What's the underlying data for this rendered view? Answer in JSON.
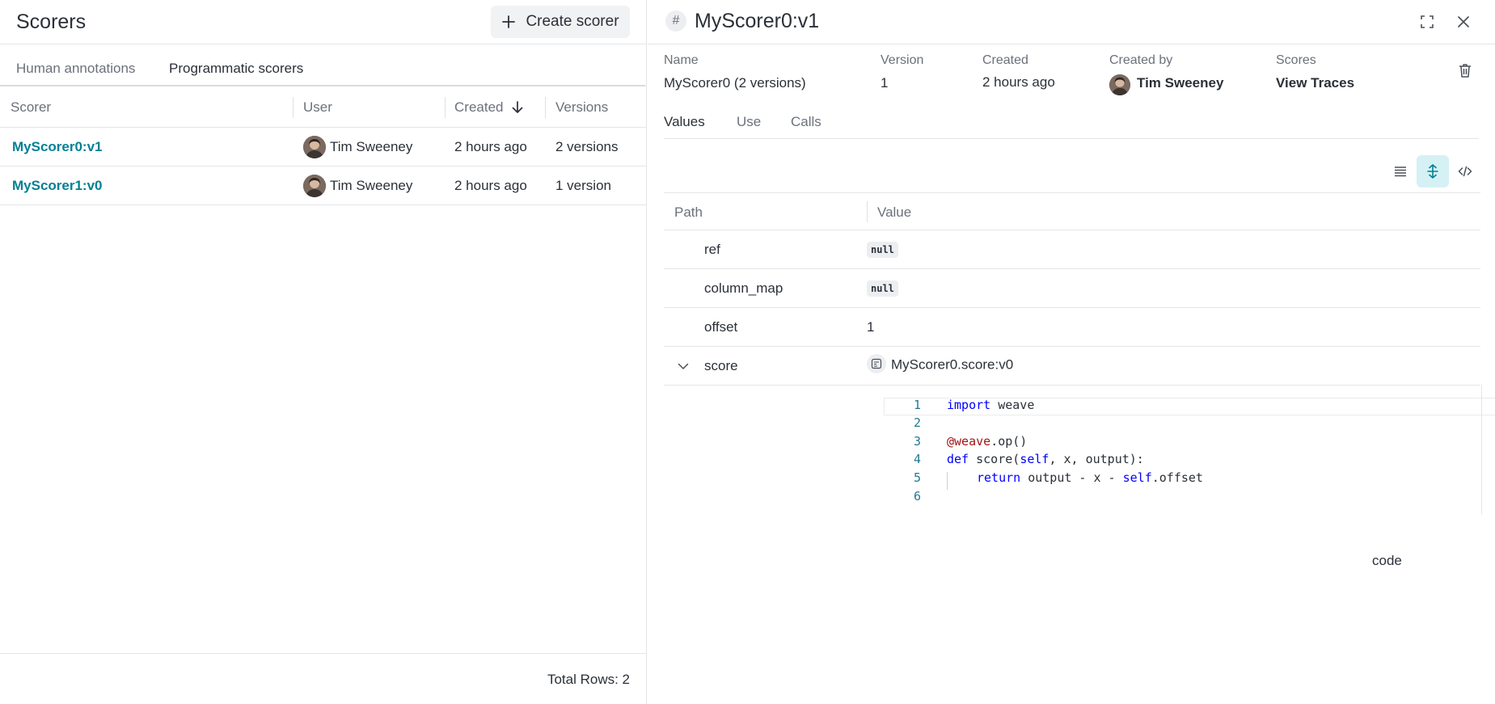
{
  "left": {
    "title": "Scorers",
    "create_button": "Create scorer",
    "tabs": [
      "Human annotations",
      "Programmatic scorers"
    ],
    "active_tab": "Programmatic scorers",
    "columns": [
      "Scorer",
      "User",
      "Created",
      "Versions"
    ],
    "rows": [
      {
        "scorer": "MyScorer0:v1",
        "user": "Tim Sweeney",
        "created": "2 hours ago",
        "versions": "2 versions"
      },
      {
        "scorer": "MyScorer1:v0",
        "user": "Tim Sweeney",
        "created": "2 hours ago",
        "versions": "1 version"
      }
    ],
    "total_rows": "Total Rows: 2"
  },
  "right": {
    "title": "MyScorer0:v1",
    "meta": {
      "name_label": "Name",
      "name_value": "MyScorer0 (2 versions)",
      "version_label": "Version",
      "version_value": "1",
      "created_label": "Created",
      "created_value": "2 hours ago",
      "created_by_label": "Created by",
      "created_by_value": "Tim Sweeney",
      "scores_label": "Scores",
      "scores_value": "View Traces"
    },
    "tabs": [
      "Values",
      "Use",
      "Calls"
    ],
    "active_tab": "Values",
    "table": {
      "columns": [
        "Path",
        "Value"
      ],
      "rows": [
        {
          "path": "ref",
          "value": "null"
        },
        {
          "path": "column_map",
          "value": "null"
        },
        {
          "path": "offset",
          "value": "1"
        },
        {
          "path": "score",
          "value": "MyScorer0.score:v0"
        }
      ]
    },
    "code": {
      "line_numbers": [
        "1",
        "2",
        "3",
        "4",
        "5",
        "6"
      ],
      "l1_kw": "import",
      "l1_rest": " weave",
      "l3_dec": "@weave",
      "l3_rest": ".op()",
      "l4_kw": "def",
      "l4_a": " score(",
      "l4_self": "self",
      "l4_b": ", x, output):",
      "l5_kw": "return",
      "l5_a": " output - x - ",
      "l5_self": "self",
      "l5_b": ".offset"
    },
    "code_label": "code"
  },
  "colors": {
    "link": "#038194",
    "active_view": "#d5f1f4",
    "keyword": "#0000ff"
  }
}
